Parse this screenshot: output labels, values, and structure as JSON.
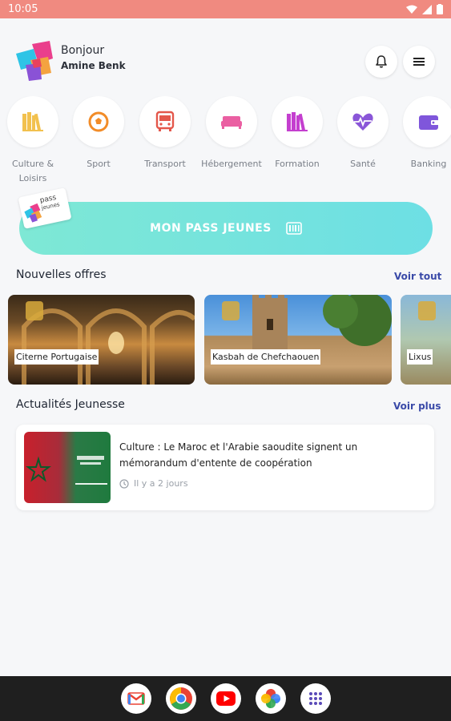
{
  "status": {
    "time": "10:05"
  },
  "header": {
    "greeting": "Bonjour",
    "user_name": "Amine Benk"
  },
  "categories": [
    {
      "label": "Culture &\nLoisirs",
      "icon": "books-icon",
      "color": "#f2c14e"
    },
    {
      "label": "Sport",
      "icon": "soccer-ball-icon",
      "color": "#f28c28"
    },
    {
      "label": "Transport",
      "icon": "bus-icon",
      "color": "#e4574b"
    },
    {
      "label": "Hébergement",
      "icon": "bed-icon",
      "color": "#ea5fa2"
    },
    {
      "label": "Formation",
      "icon": "books-icon",
      "color": "#c43fcf"
    },
    {
      "label": "Santé",
      "icon": "heart-pulse-icon",
      "color": "#8a56d8"
    },
    {
      "label": "Banking",
      "icon": "wallet-icon",
      "color": "#7f56db"
    }
  ],
  "pass": {
    "label": "MON PASS JEUNES",
    "badge_line1": "pass",
    "badge_line2": "jeunes"
  },
  "offers_section": {
    "title": "Nouvelles offres",
    "link": "Voir tout",
    "items": [
      {
        "label": "Citerne Portugaise"
      },
      {
        "label": "Kasbah de Chefchaouen"
      },
      {
        "label": "Lixus"
      }
    ]
  },
  "news_section": {
    "title": "Actualités Jeunesse",
    "link": "Voir plus",
    "items": [
      {
        "title": "Culture : Le Maroc et l'Arabie saoudite signent un mémorandum d'entente de coopération",
        "time": "Il y a 2 jours"
      }
    ]
  },
  "dock": [
    {
      "name": "Gmail"
    },
    {
      "name": "Chrome"
    },
    {
      "name": "YouTube"
    },
    {
      "name": "Photos"
    },
    {
      "name": "App drawer"
    }
  ]
}
